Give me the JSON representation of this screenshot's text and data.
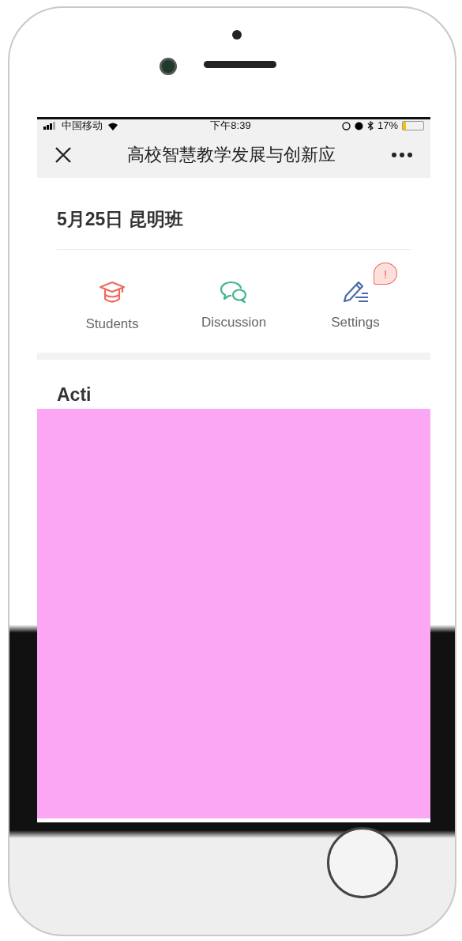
{
  "status_bar": {
    "carrier": "中国移动",
    "time": "下午8:39",
    "battery": "17%"
  },
  "nav_bar": {
    "title": "高校智慧教学发展与创新应"
  },
  "class_title": "5月25日 昆明班",
  "actions": [
    {
      "kind": "students",
      "label": "Students"
    },
    {
      "kind": "discussion",
      "label": "Discussion"
    },
    {
      "kind": "settings",
      "label": "Settings",
      "badge": "!"
    }
  ],
  "section_heading": "Acti"
}
